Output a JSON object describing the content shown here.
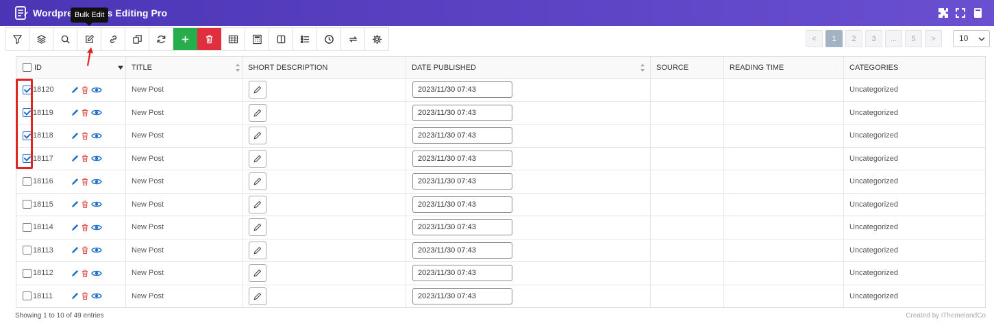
{
  "app": {
    "title": "Wordpress Posts Editing Pro"
  },
  "tooltip": {
    "text": "Bulk Edit"
  },
  "toolbar": {
    "buttons": [
      {
        "name": "filter-icon"
      },
      {
        "name": "layers-icon"
      },
      {
        "name": "search-icon"
      },
      {
        "name": "bulk-edit-icon"
      },
      {
        "name": "link-icon"
      },
      {
        "name": "duplicate-icon"
      },
      {
        "name": "refresh-icon"
      },
      {
        "name": "add-icon"
      },
      {
        "name": "delete-icon"
      },
      {
        "name": "table-icon"
      },
      {
        "name": "calculator-icon"
      },
      {
        "name": "columns-icon"
      },
      {
        "name": "list-icon"
      },
      {
        "name": "history-icon"
      },
      {
        "name": "sync-icon"
      },
      {
        "name": "settings-icon"
      }
    ],
    "add_color": "#27ae4c",
    "delete_color": "#e0303f"
  },
  "pagination": {
    "prev": "<",
    "pages": [
      "1",
      "2",
      "3",
      "...",
      "5"
    ],
    "next": ">",
    "current": "1",
    "per_page": "10"
  },
  "table": {
    "columns": {
      "id": "ID",
      "title": "TITLE",
      "short_description": "SHORT DESCRIPTION",
      "date_published": "DATE PUBLISHED",
      "source": "SOURCE",
      "reading_time": "READING TIME",
      "categories": "CATEGORIES"
    },
    "rows": [
      {
        "id": "18120",
        "title": "New Post",
        "date": "2023/11/30 07:43",
        "categories": "Uncategorized",
        "checked": true
      },
      {
        "id": "18119",
        "title": "New Post",
        "date": "2023/11/30 07:43",
        "categories": "Uncategorized",
        "checked": true
      },
      {
        "id": "18118",
        "title": "New Post",
        "date": "2023/11/30 07:43",
        "categories": "Uncategorized",
        "checked": true
      },
      {
        "id": "18117",
        "title": "New Post",
        "date": "2023/11/30 07:43",
        "categories": "Uncategorized",
        "checked": true
      },
      {
        "id": "18116",
        "title": "New Post",
        "date": "2023/11/30 07:43",
        "categories": "Uncategorized",
        "checked": false
      },
      {
        "id": "18115",
        "title": "New Post",
        "date": "2023/11/30 07:43",
        "categories": "Uncategorized",
        "checked": false
      },
      {
        "id": "18114",
        "title": "New Post",
        "date": "2023/11/30 07:43",
        "categories": "Uncategorized",
        "checked": false
      },
      {
        "id": "18113",
        "title": "New Post",
        "date": "2023/11/30 07:43",
        "categories": "Uncategorized",
        "checked": false
      },
      {
        "id": "18112",
        "title": "New Post",
        "date": "2023/11/30 07:43",
        "categories": "Uncategorized",
        "checked": false
      },
      {
        "id": "18111",
        "title": "New Post",
        "date": "2023/11/30 07:43",
        "categories": "Uncategorized",
        "checked": false
      }
    ]
  },
  "footer": {
    "entries": "Showing 1 to 10 of 49 entries",
    "credit": "Created by iThemelandCo"
  }
}
